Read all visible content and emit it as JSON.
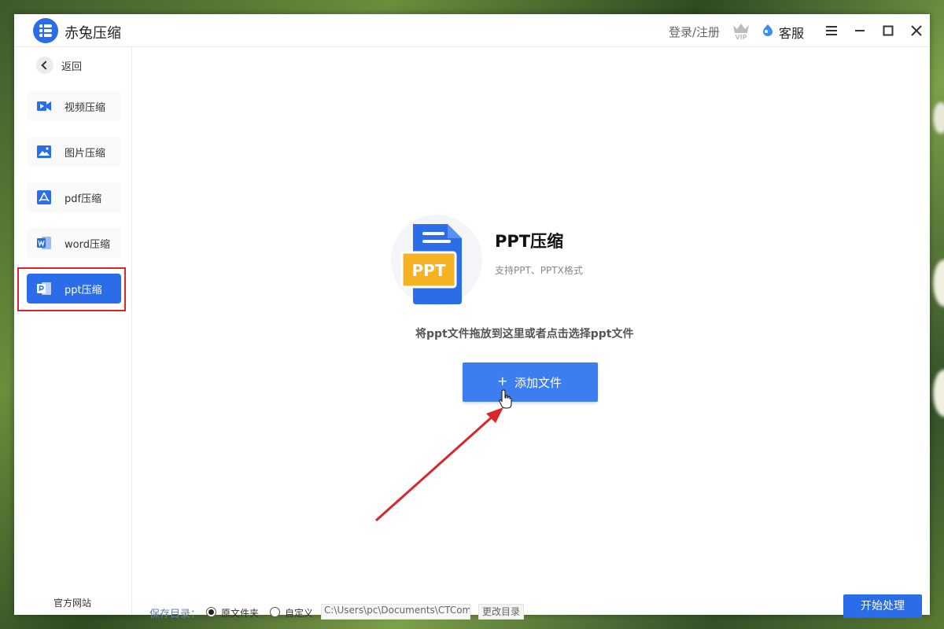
{
  "app": {
    "title": "赤兔压缩",
    "login_label": "登录/注册",
    "vip_label": "VIP",
    "service_label": "客服"
  },
  "sidebar": {
    "back_label": "返回",
    "items": [
      {
        "label": "视频压缩",
        "icon": "video-icon"
      },
      {
        "label": "图片压缩",
        "icon": "image-icon"
      },
      {
        "label": "pdf压缩",
        "icon": "pdf-icon"
      },
      {
        "label": "word压缩",
        "icon": "word-icon"
      },
      {
        "label": "ppt压缩",
        "icon": "ppt-icon",
        "active": true
      }
    ],
    "website_label": "官方网站"
  },
  "main": {
    "feature_title": "PPT压缩",
    "feature_subtitle": "支持PPT、PPTX格式",
    "graphic_text": "PPT",
    "drop_hint": "将ppt文件拖放到这里或者点击选择ppt文件",
    "add_button_plus": "+",
    "add_button_label": "添加文件"
  },
  "bottom": {
    "save_label": "保存目录：",
    "option_original": "原文件夹",
    "option_custom": "自定义",
    "selected_option": "原文件夹",
    "path_value": "C:\\Users\\pc\\Documents\\CTCom",
    "change_dir_label": "更改目录",
    "start_label": "开始处理"
  },
  "colors": {
    "accent": "#2b6de8",
    "button": "#3c7ef0",
    "highlight": "#d9262b",
    "graphic_badge": "#f5b323"
  }
}
